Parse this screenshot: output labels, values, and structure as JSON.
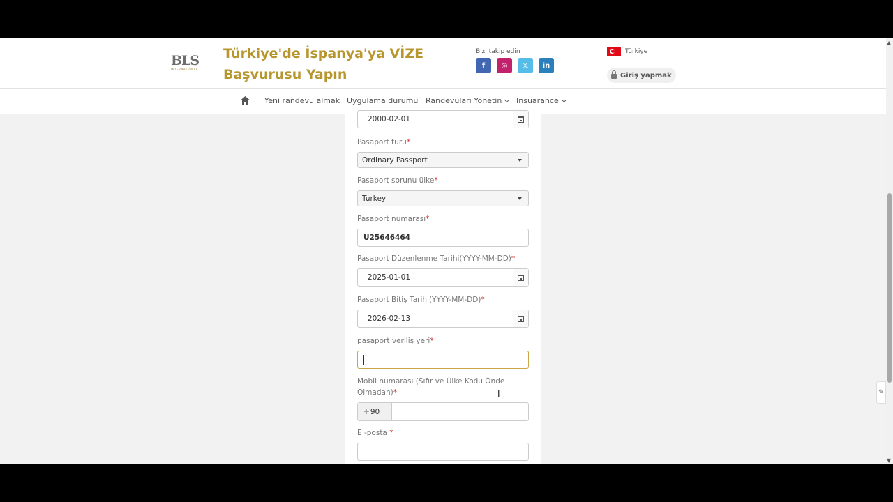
{
  "header": {
    "logo_text": "BLS",
    "logo_subtext": "INTERNATIONAL",
    "title_line1": "Türkiye'de İspanya'ya VİZE",
    "title_line2": "Başvurusu Yapın",
    "follow_label": "Bizi takip edin",
    "social": [
      {
        "name": "facebook",
        "glyph": "f",
        "color": "#4267b2"
      },
      {
        "name": "instagram",
        "glyph": "◎",
        "color": "#c2226b"
      },
      {
        "name": "x",
        "glyph": "𝕏",
        "color": "#55bde8"
      },
      {
        "name": "linkedin",
        "glyph": "in",
        "color": "#2b7fba"
      }
    ],
    "language": "Türkiye",
    "login_label": "Giriş yapmak"
  },
  "nav": {
    "home_icon": "home-icon",
    "items": [
      {
        "label": "Yeni randevu almak",
        "dropdown": false
      },
      {
        "label": "Uygulama durumu",
        "dropdown": false
      },
      {
        "label": "Randevuları Yönetin",
        "dropdown": true
      },
      {
        "label": "Insuarance",
        "dropdown": true
      }
    ]
  },
  "form": {
    "birth_date_value": "2000-02-01",
    "passport_type": {
      "label": "Pasaport türü",
      "value": "Ordinary Passport"
    },
    "passport_country": {
      "label": "Pasaport sorunu ülke",
      "value": "Turkey"
    },
    "passport_number": {
      "label": "Pasaport numarası",
      "value": "U25646464"
    },
    "issue_date": {
      "label": "Pasaport Düzenlenme Tarihi(YYYY-MM-DD)",
      "value": "2025-01-01"
    },
    "expiry_date": {
      "label": "Pasaport Bitiş Tarihi(YYYY-MM-DD)",
      "value": "2026-02-13"
    },
    "issue_place": {
      "label": "pasaport veriliş yeri",
      "value": ""
    },
    "mobile": {
      "label_line1": "Mobil numarası (Sıfır ve Ülke Kodu Önde",
      "label_line2": "Olmadan)",
      "code_plus": "+",
      "code": "90",
      "value": ""
    },
    "email": {
      "label": "E -posta ",
      "value": ""
    },
    "required_mark": "*"
  }
}
